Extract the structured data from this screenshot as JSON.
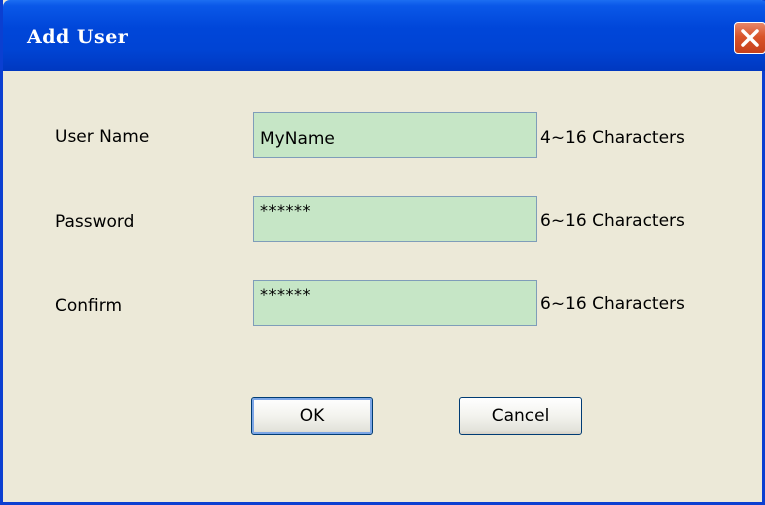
{
  "window": {
    "title": "Add User"
  },
  "form": {
    "username": {
      "label": "User Name",
      "value": "MyName",
      "hint": "4~16 Characters"
    },
    "password": {
      "label": "Password",
      "value": "******",
      "hint": "6~16 Characters"
    },
    "confirm": {
      "label": "Confirm",
      "value": "******",
      "hint": "6~16 Characters"
    }
  },
  "buttons": {
    "ok_label": "OK",
    "cancel_label": "Cancel"
  },
  "colors": {
    "titlebar": "#0046d9",
    "dialog_bg": "#ece9d8",
    "field_bg": "#c6e6c6",
    "close_button": "#d9542a"
  },
  "icons": {
    "close": "close-icon"
  }
}
